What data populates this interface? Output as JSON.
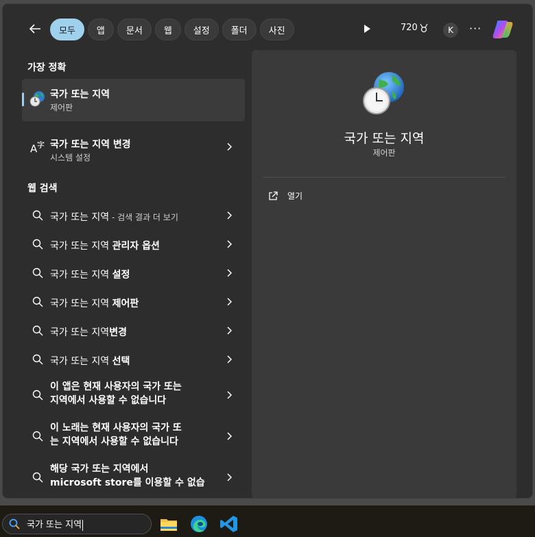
{
  "topbar": {
    "filters": [
      {
        "label": "모두",
        "active": true
      },
      {
        "label": "앱",
        "active": false
      },
      {
        "label": "문서",
        "active": false
      },
      {
        "label": "웹",
        "active": false
      },
      {
        "label": "설정",
        "active": false
      },
      {
        "label": "폴더",
        "active": false
      },
      {
        "label": "사진",
        "active": false
      }
    ],
    "points": "720",
    "avatar_letter": "K",
    "more": "···"
  },
  "left": {
    "best_match_heading": "가장 정확",
    "best_match": {
      "title": "국가 또는 지역",
      "subtitle": "제어판",
      "icon": "globe-clock-icon"
    },
    "second": {
      "title": "국가 또는 지역 변경",
      "subtitle": "시스템 설정",
      "icon": "language-icon"
    },
    "web_heading": "웹 검색",
    "web_items": [
      {
        "prefix": "국가 또는 지역",
        "bold": "",
        "suffix": " - 검색 결과 더 보기"
      },
      {
        "prefix": "국가 또는 지역 ",
        "bold": "관리자 옵션",
        "suffix": ""
      },
      {
        "prefix": "국가 또는 지역 ",
        "bold": "설정",
        "suffix": ""
      },
      {
        "prefix": "국가 또는 지역 ",
        "bold": "제어판",
        "suffix": ""
      },
      {
        "prefix": "국가 또는 지역",
        "bold": "변경",
        "suffix": ""
      },
      {
        "prefix": "국가 또는 지역 ",
        "bold": "선택",
        "suffix": ""
      },
      {
        "line1": "이 앱은 현재 사용자의 국가 또는",
        "line2": "지역에서 사용할 수 없습니다"
      },
      {
        "line1": "이 노래는 현재 사용자의 국가 또",
        "line2": "는 지역에서 사용할 수 없습니다"
      },
      {
        "line1": "해당 국가 또는 지역에서",
        "line2": "microsoft store를 이용할 수 없습"
      }
    ]
  },
  "right": {
    "title": "국가 또는 지역",
    "subtitle": "제어판",
    "open_label": "열기"
  },
  "taskbar": {
    "search_value": "국가 또는 지역"
  },
  "colors": {
    "accent": "#9fd1ec",
    "panel": "#2d2d2d",
    "detail": "#3a3a3a"
  }
}
